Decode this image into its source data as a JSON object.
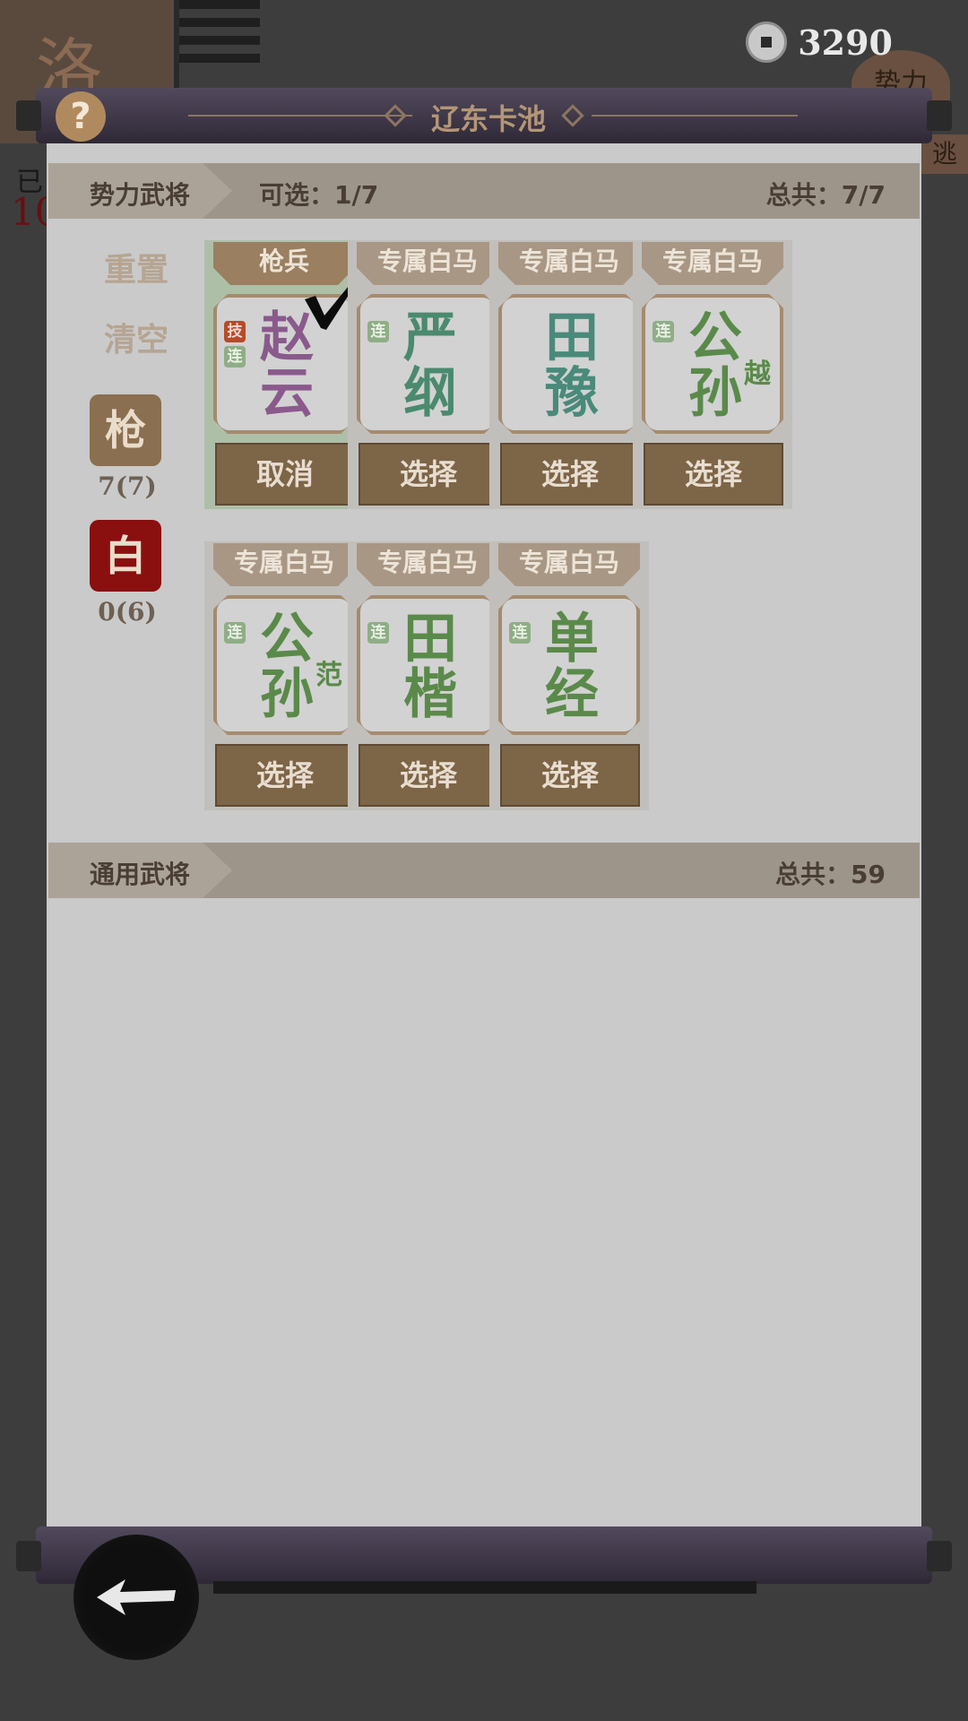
{
  "background": {
    "seal_char": "洛",
    "side_text": "已",
    "side_red": "10",
    "right_badge": "势力",
    "right_badge2": "逃"
  },
  "currency": {
    "icon": "coin-icon",
    "value": "3290"
  },
  "header": {
    "title": "辽东卡池",
    "help": "?"
  },
  "faction_section": {
    "label": "势力武将",
    "optional": "可选：1/7",
    "total": "总共：7/7"
  },
  "controls": {
    "reset": "重置",
    "clear": "清空",
    "types": [
      {
        "char": "枪",
        "count": "7(7)",
        "color": "#8a6f50"
      },
      {
        "char": "白",
        "count": "0(6)",
        "color": "#8a0f0f"
      }
    ]
  },
  "cards": [
    {
      "ribbon": "枪兵",
      "name1": "赵",
      "name2": "云",
      "extra": "",
      "tags": [
        "技",
        "连"
      ],
      "button": "取消",
      "selected": true,
      "color": "#8a5a8c"
    },
    {
      "ribbon": "专属白马",
      "name1": "严",
      "name2": "纲",
      "extra": "",
      "tags": [
        "连"
      ],
      "button": "选择",
      "selected": false,
      "color": "#4a8a6e"
    },
    {
      "ribbon": "专属白马",
      "name1": "田",
      "name2": "豫",
      "extra": "",
      "tags": [],
      "button": "选择",
      "selected": false,
      "color": "#4a8a7a"
    },
    {
      "ribbon": "专属白马",
      "name1": "公",
      "name2": "孙",
      "extra": "越",
      "tags": [
        "连"
      ],
      "button": "选择",
      "selected": false,
      "color": "#5a8a4a"
    },
    {
      "ribbon": "专属白马",
      "name1": "公",
      "name2": "孙",
      "extra": "范",
      "tags": [
        "连"
      ],
      "button": "选择",
      "selected": false,
      "color": "#5a8a4a"
    },
    {
      "ribbon": "专属白马",
      "name1": "田",
      "name2": "楷",
      "extra": "",
      "tags": [
        "连"
      ],
      "button": "选择",
      "selected": false,
      "color": "#5a8a4a"
    },
    {
      "ribbon": "专属白马",
      "name1": "单",
      "name2": "经",
      "extra": "",
      "tags": [
        "连"
      ],
      "button": "选择",
      "selected": false,
      "color": "#5a8a4a"
    }
  ],
  "general_section": {
    "label": "通用武将",
    "total": "总共：59"
  }
}
